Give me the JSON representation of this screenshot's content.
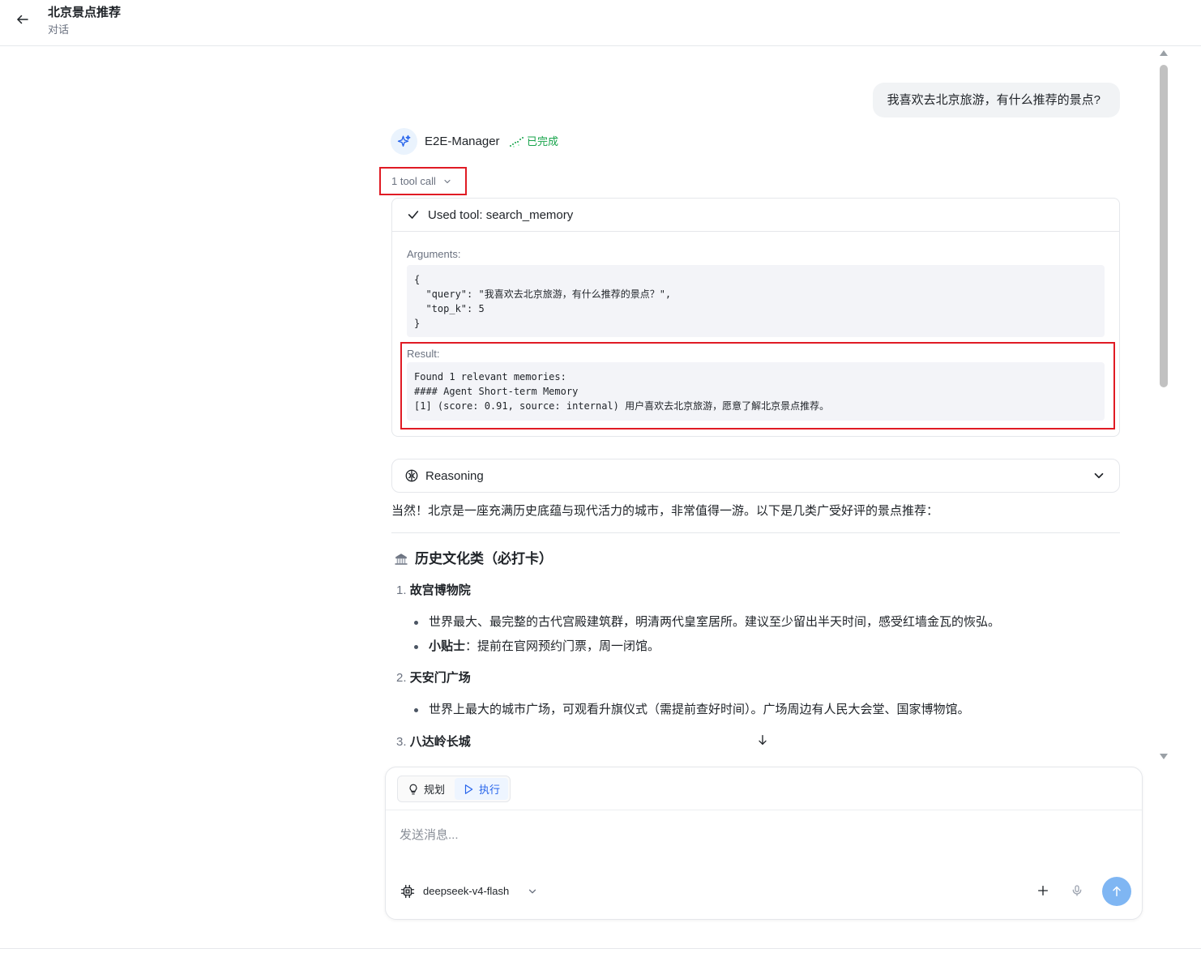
{
  "header": {
    "title": "北京景点推荐",
    "subtitle": "对话"
  },
  "user_message": "我喜欢去北京旅游，有什么推荐的景点?",
  "agent": {
    "name": "E2E-Manager",
    "status": "已完成"
  },
  "tool_call": {
    "toggle_label": "1 tool call",
    "title": "Used tool: search_memory",
    "arguments_label": "Arguments:",
    "arguments_code": "{\n  \"query\": \"我喜欢去北京旅游，有什么推荐的景点？\",\n  \"top_k\": 5\n}",
    "result_label": "Result:",
    "result_code": "Found 1 relevant memories:\n#### Agent Short-term Memory\n[1] (score: 0.91, source: internal) 用户喜欢去北京旅游，愿意了解北京景点推荐。"
  },
  "reasoning": {
    "label": "Reasoning"
  },
  "answer": {
    "intro": "当然！北京是一座充满历史底蕴与现代活力的城市，非常值得一游。以下是几类广受好评的景点推荐：",
    "section_heading": "历史文化类（必打卡）",
    "items": [
      {
        "num": "1.",
        "title": "故宫博物院",
        "bullets": [
          {
            "bold": "",
            "text": "世界最大、最完整的古代宫殿建筑群，明清两代皇室居所。建议至少留出半天时间，感受红墙金瓦的恢弘。"
          },
          {
            "bold": "小贴士",
            "text": "：提前在官网预约门票，周一闭馆。"
          }
        ]
      },
      {
        "num": "2.",
        "title": "天安门广场",
        "bullets": [
          {
            "bold": "",
            "text": "世界上最大的城市广场，可观看升旗仪式（需提前查好时间）。广场周边有人民大会堂、国家博物馆。"
          }
        ]
      },
      {
        "num": "3.",
        "title": "八达岭长城",
        "bullets": []
      }
    ]
  },
  "composer": {
    "mode_plan": "规划",
    "mode_execute": "执行",
    "placeholder": "发送消息...",
    "model": "deepseek-v4-flash"
  },
  "colors": {
    "accent": "#2563eb",
    "success": "#16a34a",
    "highlight_box": "#e01b24",
    "send_button": "#7fb6f3"
  }
}
